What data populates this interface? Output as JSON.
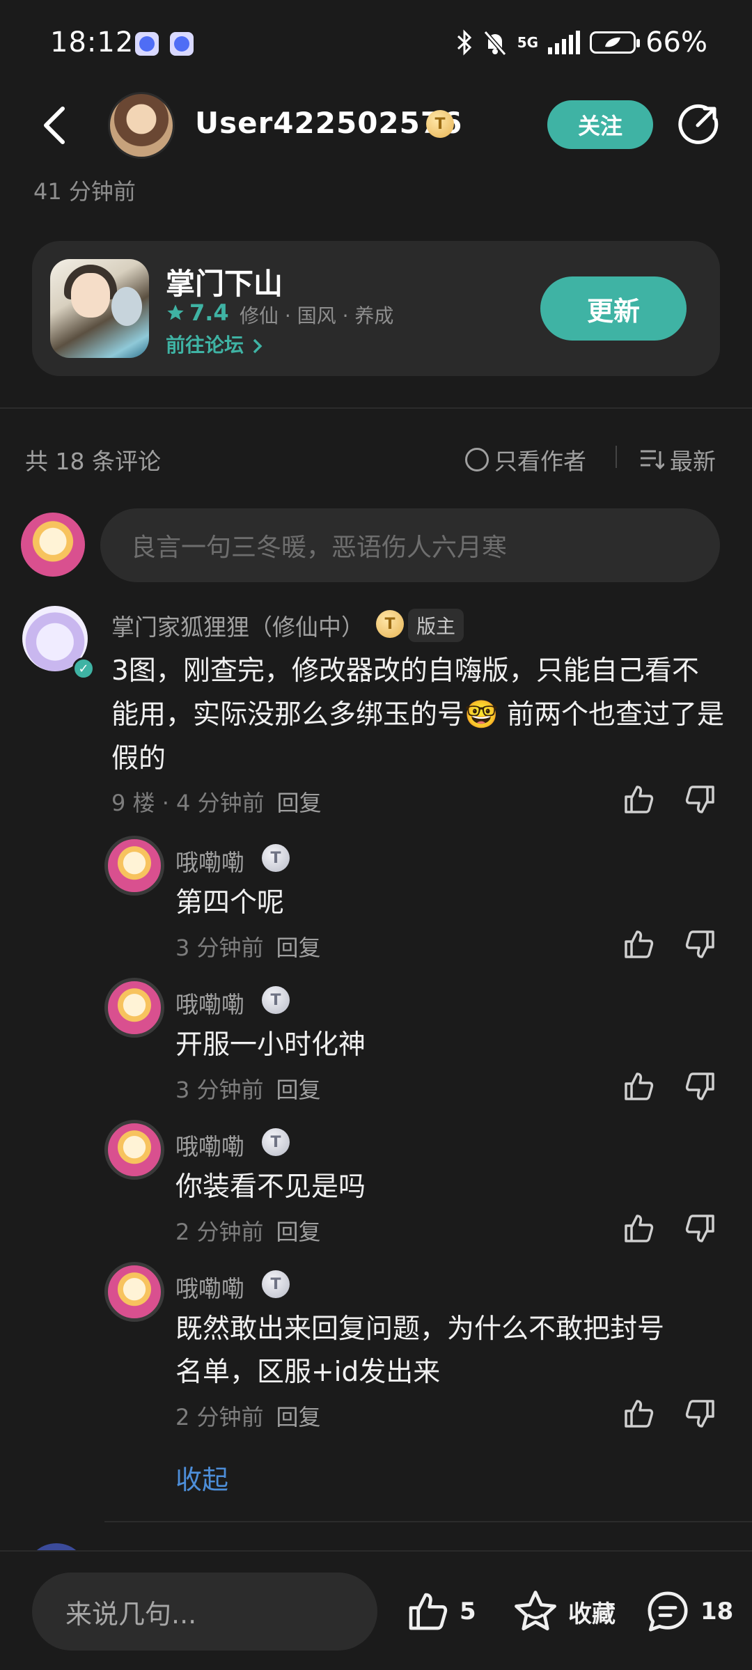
{
  "status_bar": {
    "time": "18:12",
    "network": "5G",
    "battery": "66%"
  },
  "header": {
    "username": "User422502576",
    "level_badge": "T",
    "follow_label": "关注",
    "post_time": "41 分钟前"
  },
  "game": {
    "title": "掌门下山",
    "rating": "7.4",
    "tags": "修仙 · 国风 · 养成",
    "forum_link": "前往论坛",
    "update_label": "更新"
  },
  "comments_header": {
    "count_label": "共 18 条评论",
    "only_author_label": "只看作者",
    "sort_label": "最新"
  },
  "comment_input": {
    "placeholder": "良言一句三冬暖，恶语伤人六月寒"
  },
  "main_comment": {
    "author": "掌门家狐狸狸（修仙中）",
    "level_badge": "T",
    "role": "版主",
    "text": "3图，刚查完，修改器改的自嗨版，只能自己看不能用，实际没那么多绑玉的号🤓 前两个也查过了是假的",
    "floor": "9 楼 · 4 分钟前",
    "reply_label": "回复"
  },
  "replies": [
    {
      "author": "哦嘞嘞",
      "level_badge": "T",
      "text": "第四个呢",
      "time": "3 分钟前",
      "reply_label": "回复"
    },
    {
      "author": "哦嘞嘞",
      "level_badge": "T",
      "text": "开服一小时化神",
      "time": "3 分钟前",
      "reply_label": "回复"
    },
    {
      "author": "哦嘞嘞",
      "level_badge": "T",
      "text": "你装看不见是吗",
      "time": "2 分钟前",
      "reply_label": "回复"
    },
    {
      "author": "哦嘞嘞",
      "level_badge": "T",
      "text_line1": "既然敢出来回复问题，为什么不敢把封号",
      "text_line2": "名单，区服+id发出来",
      "time": "2 分钟前",
      "reply_label": "回复"
    }
  ],
  "collapse_label": "收起",
  "bottom_bar": {
    "input_placeholder": "来说几句...",
    "like_count": "5",
    "favorite_label": "收藏",
    "comment_count": "18"
  },
  "colors": {
    "accent": "#3fb3a4",
    "link": "#4d8ed9",
    "background": "#1b1b1b"
  }
}
